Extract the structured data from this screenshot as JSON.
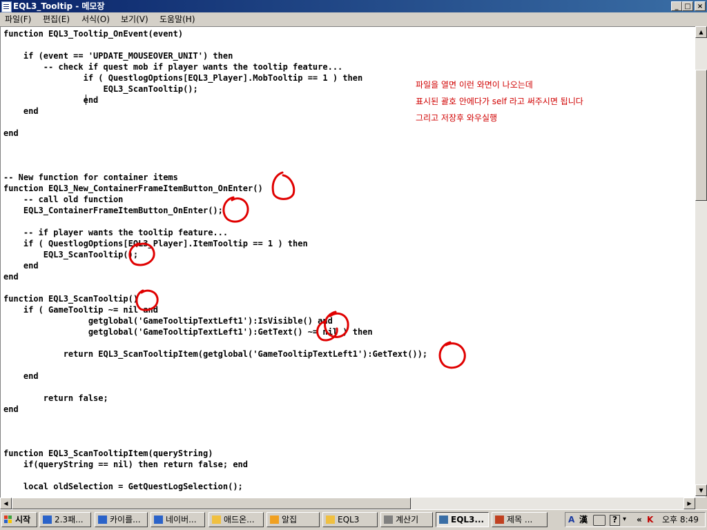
{
  "window": {
    "title": "EQL3_Tooltip - 메모장",
    "controls": {
      "minimize": "_",
      "maximize": "□",
      "close": "×"
    }
  },
  "menu": [
    "파일(F)",
    "편집(E)",
    "서식(O)",
    "보기(V)",
    "도움말(H)"
  ],
  "code_lines": [
    "function EQL3_Tooltip_OnEvent(event)",
    "",
    "    if (event == 'UPDATE_MOUSEOVER_UNIT') then",
    "        -- check if quest mob if player wants the tooltip feature...",
    "                if ( QuestlogOptions[EQL3_Player].MobTooltip == 1 ) then",
    "                    EQL3_ScanTooltip();",
    "                end",
    "    end",
    "",
    "end",
    "",
    "",
    "",
    "-- New function for container items",
    "function EQL3_New_ContainerFrameItemButton_OnEnter()",
    "    -- call old function",
    "    EQL3_ContainerFrameItemButton_OnEnter();",
    "",
    "    -- if player wants the tooltip feature...",
    "    if ( QuestlogOptions[EQL3_Player].ItemTooltip == 1 ) then",
    "        EQL3_ScanTooltip();",
    "    end",
    "end",
    "",
    "function EQL3_ScanTooltip()",
    "    if ( GameTooltip ~= nil and",
    "                 getglobal('GameTooltipTextLeft1'):IsVisible() and",
    "                 getglobal('GameTooltipTextLeft1'):GetText() ~= nil ) then",
    "",
    "            return EQL3_ScanTooltipItem(getglobal('GameTooltipTextLeft1'):GetText());",
    "",
    "    end",
    "",
    "        return false;",
    "end",
    "",
    "",
    "",
    "function EQL3_ScanTooltipItem(queryString)",
    "    if(queryString == nil) then return false; end",
    "",
    "    local oldSelection = GetQuestLogSelection();"
  ],
  "annotation_notes": [
    "파일을 열면 이런 와면이 나오는데",
    "표시된 괄호 안에다가 self 라고 써주시면 됩니다",
    "그리고 저장후 와우실행"
  ],
  "annotation_color": "#d00000",
  "taskbar": {
    "start_label": "시작",
    "buttons": [
      {
        "label": "2.3패...",
        "icon": "ie-icon"
      },
      {
        "label": "카이를...",
        "icon": "ie-icon"
      },
      {
        "label": "네이버...",
        "icon": "ie-icon"
      },
      {
        "label": "애드온...",
        "icon": "folder-icon"
      },
      {
        "label": "알집",
        "icon": "alzip-icon"
      },
      {
        "label": "EQL3",
        "icon": "folder-icon"
      },
      {
        "label": "계산기",
        "icon": "calculator-icon"
      },
      {
        "label": "EQL3...",
        "icon": "notepad-icon"
      },
      {
        "label": "제목 ...",
        "icon": "paint-icon"
      }
    ],
    "ime_mode": "A",
    "ime_hanja": "漢",
    "help": "?",
    "tray_expand": "«",
    "clock": "오후 8:49"
  }
}
